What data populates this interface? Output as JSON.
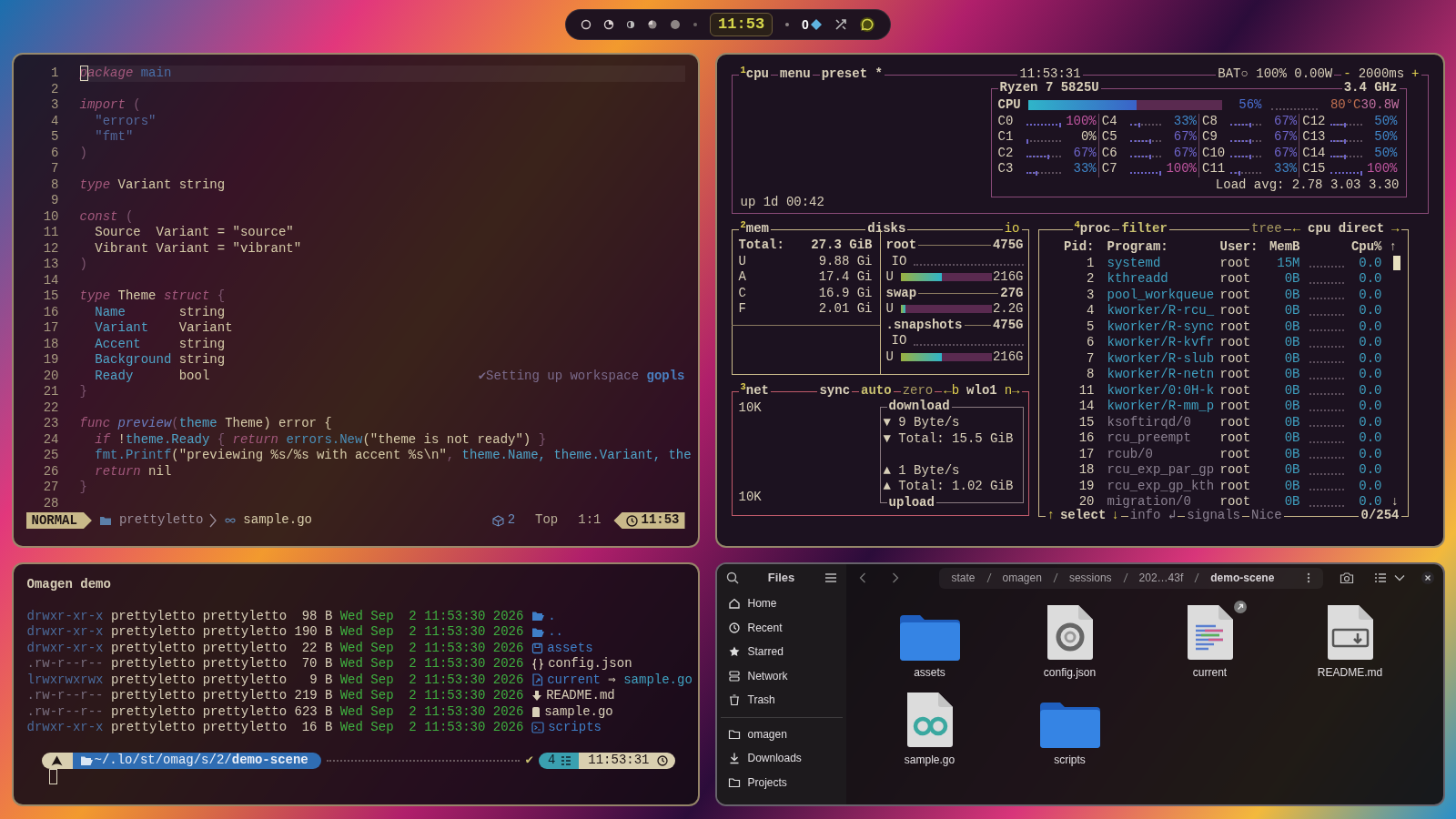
{
  "top_bar": {
    "clock": "11:53",
    "counter": "0"
  },
  "editor": {
    "lines": [
      {
        "number": "1",
        "tokens": [
          {
            "kind": "keyword",
            "text": "package",
            "cursor": true
          },
          {
            "kind": "package",
            "text": " main"
          }
        ]
      },
      {
        "number": "2"
      },
      {
        "number": "3",
        "tokens": [
          {
            "kind": "keyword",
            "text": "import"
          },
          {
            "kind": "punct",
            "text": " ("
          }
        ]
      },
      {
        "number": "4",
        "tokens": [
          {
            "kind": "string",
            "text": "  \"errors\""
          }
        ]
      },
      {
        "number": "5",
        "tokens": [
          {
            "kind": "string",
            "text": "  \"fmt\""
          }
        ]
      },
      {
        "number": "6",
        "tokens": [
          {
            "kind": "punct",
            "text": ")"
          }
        ]
      },
      {
        "number": "7"
      },
      {
        "number": "8",
        "tokens": [
          {
            "kind": "keyword",
            "text": "type"
          },
          {
            "kind": "plain",
            "text": " Variant string"
          }
        ]
      },
      {
        "number": "9"
      },
      {
        "number": "10",
        "tokens": [
          {
            "kind": "keyword",
            "text": "const"
          },
          {
            "kind": "punct",
            "text": " ("
          }
        ]
      },
      {
        "number": "11",
        "tokens": [
          {
            "kind": "plain",
            "text": "  Source  Variant = \"source\""
          }
        ]
      },
      {
        "number": "12",
        "tokens": [
          {
            "kind": "plain",
            "text": "  Vibrant Variant = \"vibrant\""
          }
        ]
      },
      {
        "number": "13",
        "tokens": [
          {
            "kind": "punct",
            "text": ")"
          }
        ]
      },
      {
        "number": "14"
      },
      {
        "number": "15",
        "tokens": [
          {
            "kind": "keyword",
            "text": "type"
          },
          {
            "kind": "plain",
            "text": " Theme "
          },
          {
            "kind": "keyword",
            "text": "struct"
          },
          {
            "kind": "punct",
            "text": " {"
          }
        ]
      },
      {
        "number": "16",
        "tokens": [
          {
            "kind": "field",
            "text": "  Name"
          },
          {
            "kind": "plain",
            "text": "       string"
          }
        ]
      },
      {
        "number": "17",
        "tokens": [
          {
            "kind": "field",
            "text": "  Variant"
          },
          {
            "kind": "plain",
            "text": "    Variant"
          }
        ]
      },
      {
        "number": "18",
        "tokens": [
          {
            "kind": "field",
            "text": "  Accent"
          },
          {
            "kind": "plain",
            "text": "     string"
          }
        ]
      },
      {
        "number": "19",
        "tokens": [
          {
            "kind": "field",
            "text": "  Background"
          },
          {
            "kind": "plain",
            "text": " string"
          }
        ]
      },
      {
        "number": "20",
        "tokens": [
          {
            "kind": "field",
            "text": "  Ready"
          },
          {
            "kind": "plain",
            "text": "      bool"
          }
        ],
        "notice": {
          "mark": "✔",
          "text": "Setting up workspace",
          "source": "gopls"
        }
      },
      {
        "number": "21",
        "tokens": [
          {
            "kind": "punct",
            "text": "}"
          }
        ]
      },
      {
        "number": "22"
      },
      {
        "number": "23",
        "tokens": [
          {
            "kind": "keyword",
            "text": "func"
          },
          {
            "kind": "function",
            "text": " preview"
          },
          {
            "kind": "punct",
            "text": "("
          },
          {
            "kind": "field",
            "text": "theme"
          },
          {
            "kind": "plain",
            "text": " Theme) error {"
          }
        ]
      },
      {
        "number": "24",
        "tokens": [
          {
            "kind": "keyword",
            "text": "  if"
          },
          {
            "kind": "plain",
            "text": " !"
          },
          {
            "kind": "field",
            "text": "theme.Ready"
          },
          {
            "kind": "punct",
            "text": " { "
          },
          {
            "kind": "keyword",
            "text": "return"
          },
          {
            "kind": "call",
            "text": " errors.New"
          },
          {
            "kind": "plain",
            "text": "(\"theme is not ready\")"
          },
          {
            "kind": "punct",
            "text": " }"
          }
        ]
      },
      {
        "number": "25",
        "tokens": [
          {
            "kind": "call",
            "text": "  fmt.Printf"
          },
          {
            "kind": "plain",
            "text": "(\"previewing %s/%s with accent %s\\n\""
          },
          {
            "kind": "punct",
            "text": ", "
          },
          {
            "kind": "field",
            "text": "theme.Name, theme.Variant, the"
          }
        ]
      },
      {
        "number": "26",
        "tokens": [
          {
            "kind": "keyword",
            "text": "  return"
          },
          {
            "kind": "plain",
            "text": " nil"
          }
        ]
      },
      {
        "number": "27",
        "tokens": [
          {
            "kind": "punct",
            "text": "}"
          }
        ]
      },
      {
        "number": "28"
      }
    ],
    "status_line": {
      "mode": "NORMAL",
      "folder": "prettyletto",
      "file": "sample.go",
      "count": "2",
      "scroll": "Top",
      "position": "1:1",
      "clock": "11:53"
    }
  },
  "system_monitor": {
    "cpu_box": {
      "title": "$^{1}$cpu",
      "menu": "menu",
      "preset": "preset *",
      "clock": "11:53:31",
      "battery": "BAT○ 100% 0.00W",
      "minus": "-",
      "interval": "2000ms",
      "plus": "+",
      "uptime": "up 1d 00:42",
      "model": "Ryzen 7 5825U",
      "frequency": "3.4 GHz",
      "total": {
        "label": "CPU",
        "level": 0.56,
        "percent": "56%",
        "temperature": "80°C",
        "power": "30.8W"
      },
      "cores": [
        {
          "label": "C0",
          "level": 1,
          "percent": "100%"
        },
        {
          "label": "C1",
          "level": 0,
          "percent": "0%"
        },
        {
          "label": "C2",
          "level": 0.67,
          "percent": "67%"
        },
        {
          "label": "C3",
          "level": 0.33,
          "percent": "33%"
        },
        {
          "label": "C4",
          "level": 0.33,
          "percent": "33%"
        },
        {
          "label": "C5",
          "level": 0.67,
          "percent": "67%"
        },
        {
          "label": "C6",
          "level": 0.67,
          "percent": "67%"
        },
        {
          "label": "C7",
          "level": 1,
          "percent": "100%"
        },
        {
          "label": "C8",
          "level": 0.67,
          "percent": "67%"
        },
        {
          "label": "C9",
          "level": 0.67,
          "percent": "67%"
        },
        {
          "label": "C10",
          "level": 0.67,
          "percent": "67%"
        },
        {
          "label": "C11",
          "level": 0.33,
          "percent": "33%"
        },
        {
          "label": "C12",
          "level": 0.5,
          "percent": "50%"
        },
        {
          "label": "C13",
          "level": 0.5,
          "percent": "50%"
        },
        {
          "label": "C14",
          "level": 0.5,
          "percent": "50%"
        },
        {
          "label": "C15",
          "level": 1,
          "percent": "100%"
        }
      ],
      "load": "Load avg: 2.78 3.03 3.30"
    },
    "mem_box": {
      "title": "$^{2}$mem",
      "total_label": "Total:",
      "total": "27.3 GiB",
      "rows": [
        {
          "label": "U",
          "value": "9.88 Gi"
        },
        {
          "label": "A",
          "value": "17.4 Gi"
        },
        {
          "label": "C",
          "value": "16.9 Gi"
        },
        {
          "label": "F",
          "value": "2.01 Gi"
        }
      ],
      "disks_title": "disks",
      "io_title": "io",
      "disks": [
        {
          "name": "root",
          "size": "475G",
          "io_label": "IO",
          "used_label": "U",
          "level": 0.45,
          "used": "216G"
        },
        {
          "name": "swap",
          "size": "27G",
          "used_label": "U",
          "level": 0.05,
          "used": "2.2G"
        },
        {
          "name": ".snapshots",
          "size": "475G",
          "io_label": "IO",
          "used_label": "U",
          "level": 0.45,
          "used": "216G"
        }
      ]
    },
    "net_box": {
      "title": "$^{3}$net",
      "sync": "sync",
      "auto": "auto",
      "zero": "zero",
      "prev": "←b",
      "interface": "wlo1",
      "next": "n→",
      "scale_top": "10K",
      "scale_bottom": "10K",
      "download": {
        "label": "download",
        "rate": "▼ 9 Byte/s",
        "total": "▼ Total: 15.5 GiB"
      },
      "upload": {
        "label": "upload",
        "rate": "▲ 1 Byte/s",
        "total": "▲ Total: 1.02 GiB"
      }
    },
    "proc_box": {
      "title": "$^{4}$proc",
      "filter": "filter",
      "tree": "tree",
      "sort_prev": "←",
      "sort": "cpu direct",
      "sort_next": "→",
      "columns": [
        "Pid:",
        "Program:",
        "User:",
        "MemB",
        "Cpu%"
      ],
      "sort_arrow": "↑",
      "scroll_down": "↓",
      "rows": [
        {
          "pid": "1",
          "program": "systemd",
          "user": "root",
          "mem": "15M",
          "cpu": "0.0",
          "dimmed": false
        },
        {
          "pid": "2",
          "program": "kthreadd",
          "user": "root",
          "mem": "0B",
          "cpu": "0.0",
          "dimmed": false
        },
        {
          "pid": "3",
          "program": "pool_workqueue",
          "user": "root",
          "mem": "0B",
          "cpu": "0.0",
          "dimmed": false
        },
        {
          "pid": "4",
          "program": "kworker/R-rcu_",
          "user": "root",
          "mem": "0B",
          "cpu": "0.0",
          "dimmed": false
        },
        {
          "pid": "5",
          "program": "kworker/R-sync",
          "user": "root",
          "mem": "0B",
          "cpu": "0.0",
          "dimmed": false
        },
        {
          "pid": "6",
          "program": "kworker/R-kvfr",
          "user": "root",
          "mem": "0B",
          "cpu": "0.0",
          "dimmed": false
        },
        {
          "pid": "7",
          "program": "kworker/R-slub",
          "user": "root",
          "mem": "0B",
          "cpu": "0.0",
          "dimmed": false
        },
        {
          "pid": "8",
          "program": "kworker/R-netn",
          "user": "root",
          "mem": "0B",
          "cpu": "0.0",
          "dimmed": false
        },
        {
          "pid": "11",
          "program": "kworker/0:0H-k",
          "user": "root",
          "mem": "0B",
          "cpu": "0.0",
          "dimmed": false
        },
        {
          "pid": "14",
          "program": "kworker/R-mm_p",
          "user": "root",
          "mem": "0B",
          "cpu": "0.0",
          "dimmed": false
        },
        {
          "pid": "15",
          "program": "ksoftirqd/0",
          "user": "root",
          "mem": "0B",
          "cpu": "0.0",
          "dimmed": true
        },
        {
          "pid": "16",
          "program": "rcu_preempt",
          "user": "root",
          "mem": "0B",
          "cpu": "0.0",
          "dimmed": true
        },
        {
          "pid": "17",
          "program": "rcub/0",
          "user": "root",
          "mem": "0B",
          "cpu": "0.0",
          "dimmed": true
        },
        {
          "pid": "18",
          "program": "rcu_exp_par_gp",
          "user": "root",
          "mem": "0B",
          "cpu": "0.0",
          "dimmed": true
        },
        {
          "pid": "19",
          "program": "rcu_exp_gp_kth",
          "user": "root",
          "mem": "0B",
          "cpu": "0.0",
          "dimmed": true
        },
        {
          "pid": "20",
          "program": "migration/0",
          "user": "root",
          "mem": "0B",
          "cpu": "0.0",
          "dimmed": true
        }
      ],
      "footer": {
        "up": "↑",
        "select": "select",
        "down": "↓",
        "info": "info ↲",
        "signals": "signals",
        "nice": "Nice",
        "count": "0/254"
      }
    }
  },
  "terminal": {
    "title": "Omagen demo",
    "listing": [
      {
        "permissions": "drwxr-xr-x",
        "owner": "prettyletto",
        "group": "prettyletto",
        "size": "98",
        "unit": "B",
        "date": "Wed Sep  2 11:53:30 2026",
        "kind": "open_folder",
        "name": "."
      },
      {
        "permissions": "drwxr-xr-x",
        "owner": "prettyletto",
        "group": "prettyletto",
        "size": "190",
        "unit": "B",
        "date": "Wed Sep  2 11:53:30 2026",
        "kind": "open_folder",
        "name": ".."
      },
      {
        "permissions": "drwxr-xr-x",
        "owner": "prettyletto",
        "group": "prettyletto",
        "size": "22",
        "unit": "B",
        "date": "Wed Sep  2 11:53:30 2026",
        "kind": "assets",
        "name": "assets"
      },
      {
        "permissions": ".rw-r--r--",
        "owner": "prettyletto",
        "group": "prettyletto",
        "size": "70",
        "unit": "B",
        "date": "Wed Sep  2 11:53:30 2026",
        "kind": "json",
        "name": "config.json"
      },
      {
        "permissions": "lrwxrwxrwx",
        "owner": "prettyletto",
        "group": "prettyletto",
        "size": "9",
        "unit": "B",
        "date": "Wed Sep  2 11:53:30 2026",
        "kind": "symlink",
        "name": "current",
        "arrow": "⇒",
        "target": "sample.go"
      },
      {
        "permissions": ".rw-r--r--",
        "owner": "prettyletto",
        "group": "prettyletto",
        "size": "219",
        "unit": "B",
        "date": "Wed Sep  2 11:53:30 2026",
        "kind": "markdown",
        "name": "README.md"
      },
      {
        "permissions": ".rw-r--r--",
        "owner": "prettyletto",
        "group": "prettyletto",
        "size": "623",
        "unit": "B",
        "date": "Wed Sep  2 11:53:30 2026",
        "kind": "go",
        "name": "sample.go"
      },
      {
        "permissions": "drwxr-xr-x",
        "owner": "prettyletto",
        "group": "prettyletto",
        "size": "16",
        "unit": "B",
        "date": "Wed Sep  2 11:53:30 2026",
        "kind": "scripts",
        "name": "scripts"
      }
    ],
    "prompt": {
      "path": "~/.lo/st/omag/s/2/**demo-scene**",
      "status": "✔",
      "jobs": "4",
      "time": "11:53:31"
    }
  },
  "file_manager": {
    "title": "Files",
    "places": [
      {
        "label": "Home",
        "kind": "home",
        "selected": false
      },
      {
        "label": "Recent",
        "kind": "recent",
        "selected": false
      },
      {
        "label": "Starred",
        "kind": "starred",
        "selected": false
      },
      {
        "label": "Network",
        "kind": "network",
        "selected": false
      },
      {
        "label": "Trash",
        "kind": "trash",
        "selected": false
      }
    ],
    "bookmarks": [
      {
        "label": "omagen",
        "kind": "folder",
        "selected": false
      },
      {
        "label": "Downloads",
        "kind": "downloads",
        "selected": false
      },
      {
        "label": "Projects",
        "kind": "folder",
        "selected": false
      }
    ],
    "path": [
      {
        "label": "state",
        "current": false
      },
      {
        "label": "omagen",
        "current": false
      },
      {
        "label": "sessions",
        "current": false
      },
      {
        "label": "202…43f",
        "current": false
      },
      {
        "label": "demo-scene",
        "current": true
      }
    ],
    "items": [
      {
        "name": "assets",
        "kind": "folder"
      },
      {
        "name": "config.json",
        "kind": "json"
      },
      {
        "name": "current",
        "kind": "text",
        "symlink": true
      },
      {
        "name": "README.md",
        "kind": "markdown"
      },
      {
        "name": "sample.go",
        "kind": "go"
      },
      {
        "name": "scripts",
        "kind": "folder"
      }
    ]
  }
}
